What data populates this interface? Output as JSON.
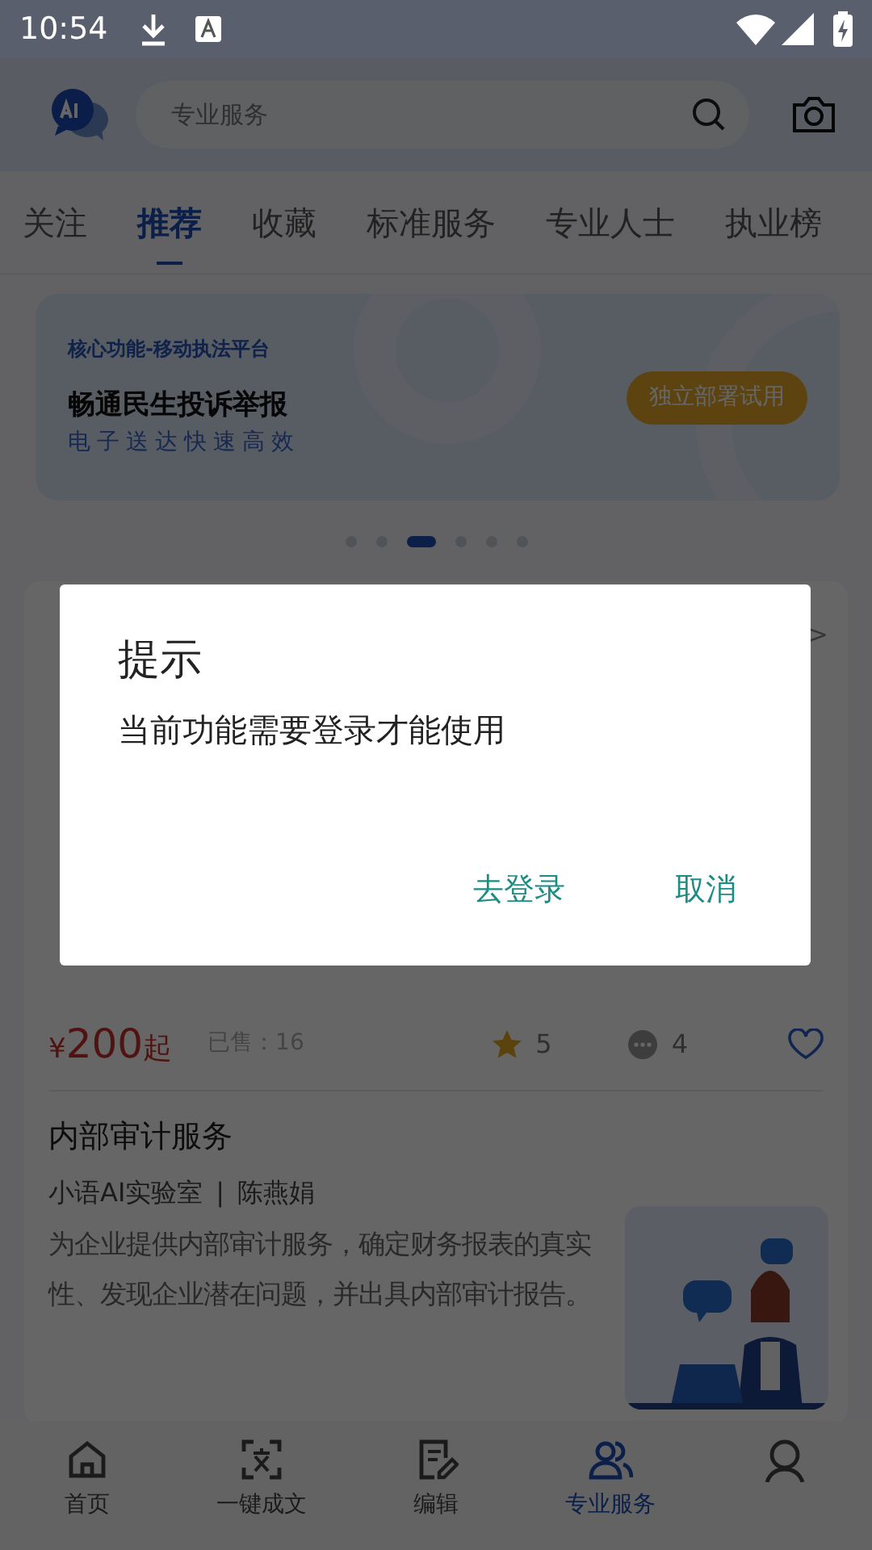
{
  "status_bar": {
    "time": "10:54"
  },
  "search": {
    "placeholder": "专业服务"
  },
  "tabs": [
    {
      "label": "关注",
      "selected": false
    },
    {
      "label": "推荐",
      "selected": true
    },
    {
      "label": "收藏",
      "selected": false
    },
    {
      "label": "标准服务",
      "selected": false
    },
    {
      "label": "专业人士",
      "selected": false
    },
    {
      "label": "执业榜",
      "selected": false
    }
  ],
  "banner": {
    "eyebrow": "核心功能-移动执法平台",
    "title": "畅通民生投诉举报",
    "subtitle": "电子送达快速高效",
    "button": "独立部署试用"
  },
  "carousel_dots": [
    {
      "selected": false
    },
    {
      "selected": false
    },
    {
      "selected": true
    },
    {
      "selected": false
    },
    {
      "selected": false
    },
    {
      "selected": false
    }
  ],
  "service_list": {
    "more": ">",
    "first_item": {
      "currency": "¥",
      "amount": "200",
      "suffix": "起",
      "sold": "已售：16",
      "rating": "5",
      "comments": "4",
      "favorited": false
    },
    "second_item": {
      "title": "内部审计服务",
      "provider": "小语AI实验室",
      "separator": "|",
      "author": "陈燕娟",
      "description": "为企业提供内部审计服务，确定财务报表的真实性、发现企业潜在问题，并出具内部审计报告。"
    }
  },
  "bottom_nav": [
    {
      "kind": "home",
      "label": "首页",
      "selected": false
    },
    {
      "kind": "scan-text",
      "label": "一键成文",
      "selected": false
    },
    {
      "kind": "edit",
      "label": "编辑",
      "selected": false
    },
    {
      "kind": "people",
      "label": "专业服务",
      "selected": true
    },
    {
      "kind": "person",
      "selected": false
    }
  ],
  "dialog": {
    "title": "提示",
    "message": "当前功能需要登录才能使用",
    "buttons": [
      "去登录",
      "取消"
    ]
  }
}
